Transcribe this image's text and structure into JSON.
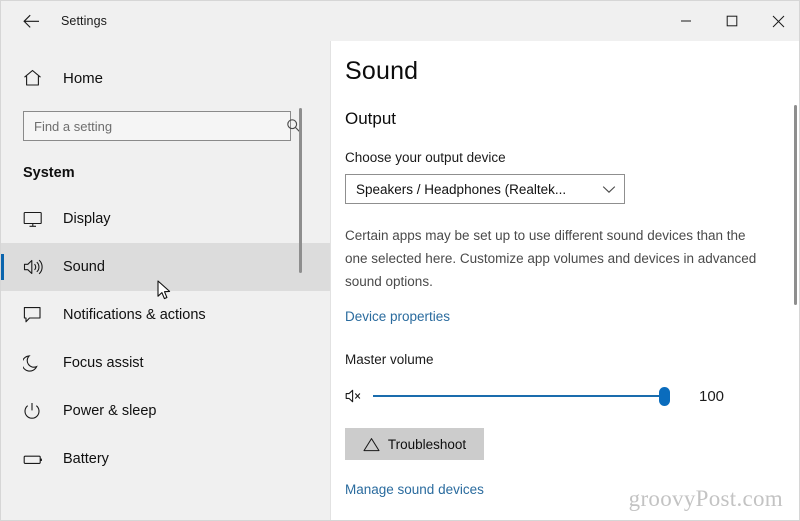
{
  "titlebar": {
    "back_icon": "back-arrow-icon",
    "title": "Settings",
    "minimize_label": "–",
    "maximize_label": "□",
    "close_label": "✕"
  },
  "sidebar": {
    "home": {
      "label": "Home",
      "icon": "home-icon"
    },
    "search": {
      "value": "",
      "placeholder": "Find a setting",
      "icon": "search-icon"
    },
    "section_title": "System",
    "items": [
      {
        "label": "Display",
        "icon": "monitor-icon",
        "selected": false
      },
      {
        "label": "Sound",
        "icon": "speaker-icon",
        "selected": true
      },
      {
        "label": "Notifications & actions",
        "icon": "chat-bubble-icon",
        "selected": false
      },
      {
        "label": "Focus assist",
        "icon": "moon-icon",
        "selected": false
      },
      {
        "label": "Power & sleep",
        "icon": "power-icon",
        "selected": false
      },
      {
        "label": "Battery",
        "icon": "battery-icon",
        "selected": false
      }
    ]
  },
  "content": {
    "page_title": "Sound",
    "section_output": "Output",
    "output_device_label": "Choose your output device",
    "output_device_value": "Speakers / Headphones (Realtek...",
    "output_device_chevron": "chevron-down-icon",
    "output_description": "Certain apps may be set up to use different sound devices than the one selected here. Customize app volumes and devices in advanced sound options.",
    "device_properties_link": "Device properties",
    "master_volume_label": "Master volume",
    "mute_icon": "speaker-mute-icon",
    "volume_value": "100",
    "volume_percent": 100,
    "troubleshoot_button": "Troubleshoot",
    "troubleshoot_icon": "warning-triangle-icon",
    "manage_sound_devices_link": "Manage sound devices"
  },
  "watermark": "groovyPost.com",
  "colors": {
    "accent_blue": "#0a64ad",
    "link_blue": "#2a6b9e",
    "slider_blue": "#0a6cbd",
    "sidebar_bg": "#f0f0f0",
    "selected_bg": "#dcdcdc",
    "button_bg": "#cccccc"
  }
}
